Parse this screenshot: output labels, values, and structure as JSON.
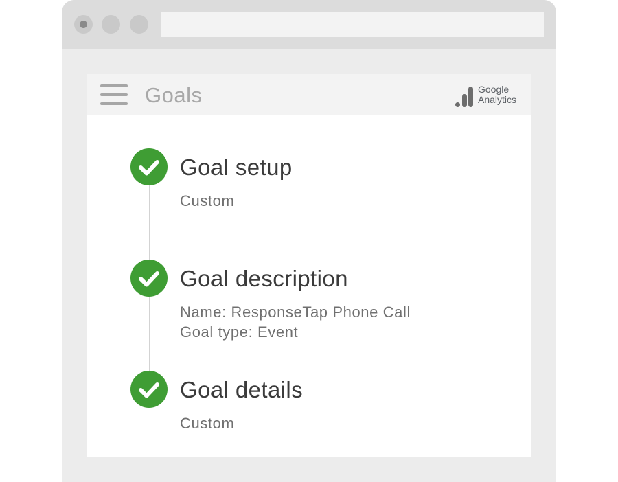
{
  "app": {
    "title": "Goals",
    "logo": {
      "line1": "Google",
      "line2": "Analytics"
    }
  },
  "colors": {
    "check": "#3f9d34",
    "window_frame": "#ececec",
    "titlebar": "#dcdcdc"
  },
  "steps": [
    {
      "title": "Goal setup",
      "details": [
        "Custom"
      ]
    },
    {
      "title": "Goal description",
      "details": [
        "Name: ResponseTap Phone Call",
        "Goal type: Event"
      ]
    },
    {
      "title": "Goal details",
      "details": [
        "Custom"
      ]
    }
  ]
}
